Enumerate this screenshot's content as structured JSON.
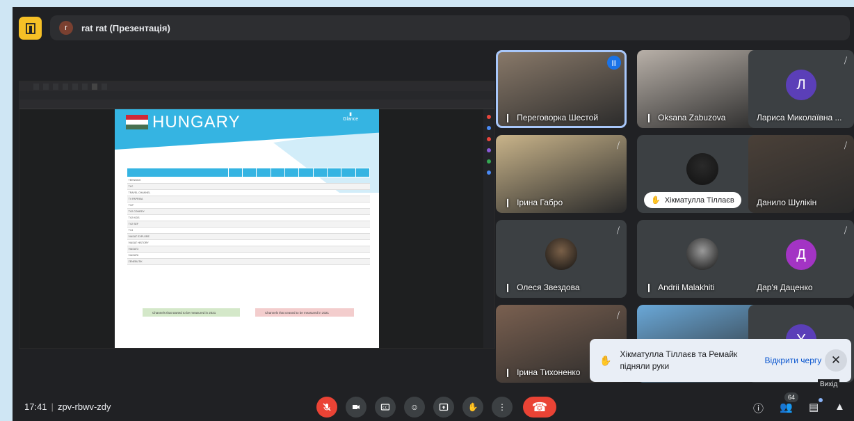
{
  "meeting": {
    "logo_glyph": "Д",
    "presenter_initial": "r",
    "presentation_title": "rat rat (Презентація)",
    "time": "17:41",
    "code": "zpv-rbwv-zdy",
    "participant_count": "64"
  },
  "shared_screen": {
    "tabs": [
      "",
      "",
      "",
      "",
      "",
      "",
      "",
      ""
    ],
    "url": "",
    "toolbar": [
      "",
      "",
      "",
      ""
    ],
    "document": {
      "country": "HUNGARY",
      "logo_text": "Glance",
      "table_headers": [
        "",
        "",
        "",
        "",
        "",
        "",
        "",
        "",
        "",
        "",
        ""
      ],
      "rows": [
        [
          "TEENNICK",
          "",
          "",
          "",
          "",
          "",
          "",
          "",
          "",
          "",
          ""
        ],
        [
          "TLC",
          "",
          "",
          "",
          "",
          "",
          "",
          "",
          "",
          "",
          ""
        ],
        [
          "TRAVEL CHANNEL",
          "",
          "",
          "",
          "",
          "",
          "",
          "",
          "",
          "",
          ""
        ],
        [
          "TV PAPRIKA",
          "",
          "",
          "",
          "",
          "",
          "",
          "",
          "",
          "",
          ""
        ],
        [
          "TV2*",
          "",
          "",
          "",
          "",
          "",
          "",
          "",
          "",
          "",
          ""
        ],
        [
          "TV2 COMEDY",
          "",
          "",
          "",
          "",
          "",
          "",
          "",
          "",
          "",
          ""
        ],
        [
          "TV2 KIDS",
          "",
          "",
          "",
          "",
          "",
          "",
          "",
          "",
          "",
          ""
        ],
        [
          "TV2 SEF",
          "",
          "",
          "",
          "",
          "",
          "",
          "",
          "",
          "",
          ""
        ],
        [
          "TV4",
          "",
          "",
          "",
          "",
          "",
          "",
          "",
          "",
          "",
          ""
        ],
        [
          "VIASAT EXPLORE",
          "",
          "",
          "",
          "",
          "",
          "",
          "",
          "",
          "",
          ""
        ],
        [
          "VIASAT HISTORY",
          "",
          "",
          "",
          "",
          "",
          "",
          "",
          "",
          "",
          ""
        ],
        [
          "VIASAT3",
          "",
          "",
          "",
          "",
          "",
          "",
          "",
          "",
          "",
          ""
        ],
        [
          "VIASAT6",
          "",
          "",
          "",
          "",
          "",
          "",
          "",
          "",
          "",
          ""
        ],
        [
          "ZENEBUTIK",
          "",
          "",
          "",
          "",
          "",
          "",
          "",
          "",
          "",
          ""
        ]
      ],
      "started_label": "Channels that started to be measured in 2021",
      "ceased_label": "Channels that ceased to be measured in 2021",
      "started_items": [
        "",
        ""
      ]
    }
  },
  "participants": [
    {
      "name": "Переговорка Шестой",
      "type": "photo",
      "color": "#8a7a6a",
      "speaking": true
    },
    {
      "name": "Oksana Zabuzova",
      "type": "photo",
      "color": "#b8b0a8"
    },
    {
      "name": "Лариса Миколаївна ...",
      "type": "avatar",
      "initial": "Л",
      "color": "#5b3fb8"
    },
    {
      "name": "Ірина Габро",
      "type": "photo",
      "color": "#c9b48a"
    },
    {
      "name": "Хікматулла Тіллаєв",
      "type": "photo-pill",
      "color": "#2a2a2a"
    },
    {
      "name": "Данило Шулікін",
      "type": "photo",
      "color": "#4a4038"
    },
    {
      "name": "Олеся Звездова",
      "type": "photo-small",
      "color": "#7a6048"
    },
    {
      "name": "Andrii Malakhiti",
      "type": "photo-small",
      "color": "#9a9a9a"
    },
    {
      "name": "Дар'я Даценко",
      "type": "avatar",
      "initial": "Д",
      "color": "#a334c4"
    },
    {
      "name": "Ірина Тихоненко",
      "type": "photo",
      "color": "#7a6050"
    },
    {
      "name": "",
      "type": "photo",
      "color": "#6aa8d8"
    },
    {
      "name": "",
      "type": "avatar",
      "initial": "Y",
      "color": "#5b3fb8"
    }
  ],
  "toast": {
    "text": "Хікматулла Тіллаєв та Ремайк підняли руки",
    "link": "Відкрити чергу",
    "close_tooltip": "Вихід"
  },
  "colors": {
    "background": "#202124",
    "danger": "#ea4335",
    "accent": "#1a73e8"
  }
}
